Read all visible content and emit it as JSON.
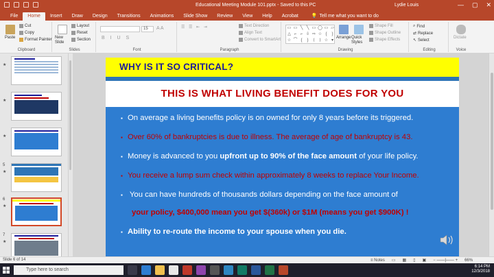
{
  "window": {
    "title": "Educational Meeting Module 101.pptx  -  Saved to this PC",
    "user": "Lydie Louis",
    "controls": [
      "—",
      "▢",
      "✕"
    ]
  },
  "ribbon_tabs": [
    "File",
    "Home",
    "Insert",
    "Draw",
    "Design",
    "Transitions",
    "Animations",
    "Slide Show",
    "Review",
    "View",
    "Help",
    "Acrobat"
  ],
  "active_tab": "Home",
  "tell_me": "Tell me what you want to do",
  "ribbon": {
    "clipboard": {
      "cut": "Cut",
      "copy": "Copy",
      "format_painter": "Format Painter",
      "paste": "Paste",
      "label": "Clipboard"
    },
    "slides": {
      "new_slide": "New Slide",
      "layout": "Layout",
      "reset": "Reset",
      "section": "Section",
      "label": "Slides"
    },
    "font": {
      "size": "15",
      "label": "Font"
    },
    "paragraph": {
      "text_direction": "Text Direction",
      "align_text": "Align Text",
      "convert_smartart": "Convert to SmartArt",
      "label": "Paragraph"
    },
    "drawing": {
      "arrange": "Arrange",
      "quick_styles": "Quick Styles",
      "shape_fill": "Shape Fill",
      "shape_outline": "Shape Outline",
      "shape_effects": "Shape Effects",
      "label": "Drawing"
    },
    "editing": {
      "find": "Find",
      "replace": "Replace",
      "select": "Select",
      "label": "Editing"
    },
    "voice": {
      "dictate": "Dictate",
      "label": "Voice"
    }
  },
  "thumbnails": [
    {
      "num": "",
      "star": "★"
    },
    {
      "num": "",
      "star": "★"
    },
    {
      "num": "",
      "star": "★"
    },
    {
      "num": "5",
      "star": "★"
    },
    {
      "num": "6",
      "star": "★"
    },
    {
      "num": "7",
      "star": "★"
    }
  ],
  "slide": {
    "question": "WHY IS IT SO CRITICAL?",
    "headline": "THIS IS WHAT LIVING BENEFIT DOES FOR YOU",
    "bullet_glyph": "▪",
    "bullets": [
      {
        "color": "white",
        "pre": "On average a living benefits policy is on owned for only 8 years before its triggered.",
        "bold": "",
        "post": ""
      },
      {
        "color": "red",
        "pre": "Over 60% of bankruptcies is due to illness.  The average of age of bankruptcy is 43.",
        "bold": "",
        "post": ""
      },
      {
        "color": "white",
        "pre": "Money is advanced to you ",
        "bold": "upfront up to 90% of the face amount",
        "post": " of your life policy."
      },
      {
        "color": "red",
        "pre": "You receive a lump sum check within approximately 8 weeks to replace Your Income.",
        "bold": "",
        "post": ""
      },
      {
        "color": "white",
        "pre": " You can have hundreds of thousands dollars depending on the face amount of",
        "bold": "",
        "post": ""
      },
      {
        "color": "red",
        "pre": "",
        "bold": "your policy, $400,000  mean you get $(360k) or $1M (means you get $900K) !",
        "post": ""
      },
      {
        "color": "white",
        "pre": "",
        "bold": "Ability to re-route the income to your spouse when you die.",
        "post": ""
      }
    ]
  },
  "status": {
    "slide_of": "Slide 6 of 14",
    "notes": "Notes",
    "zoom": "66%"
  },
  "taskbar": {
    "search_placeholder": "Type here to search",
    "time": "6:14 PM",
    "date": "12/3/2018"
  },
  "colors": {
    "accent": "#b7472a",
    "slide_blue": "#2e7dd1",
    "slide_yellow": "#ffff00",
    "headline_red": "#c00000",
    "title_navy": "#1b1b9a"
  }
}
